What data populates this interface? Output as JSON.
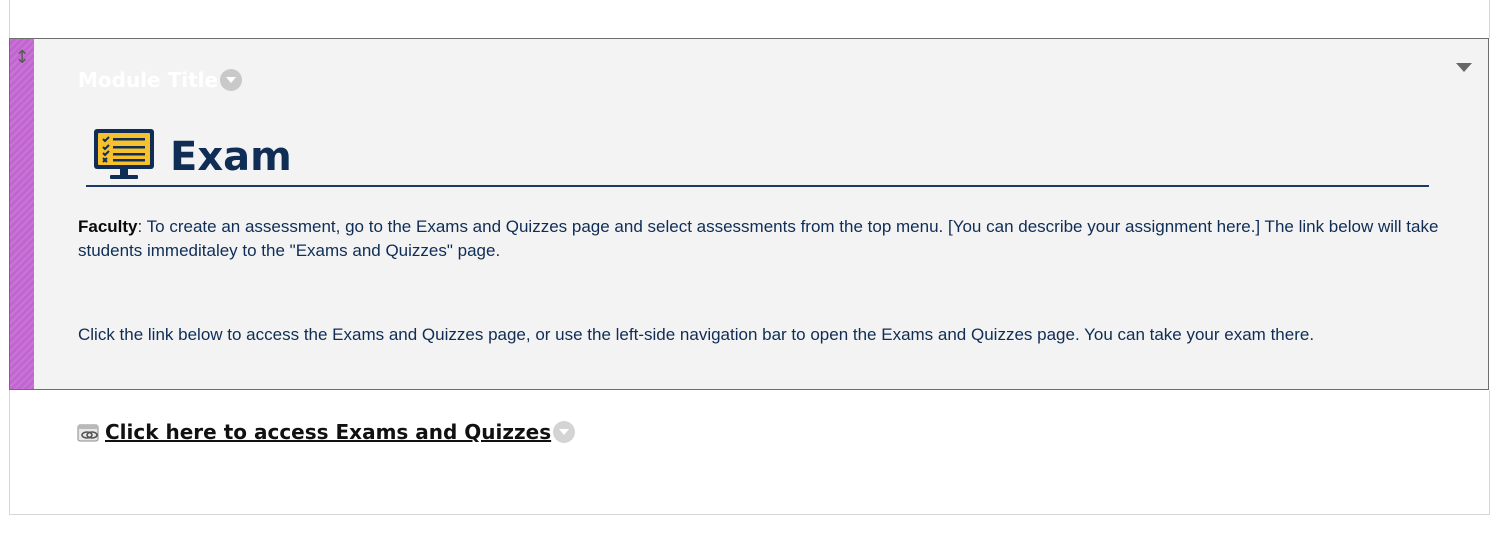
{
  "module": {
    "title": "Module Title",
    "accent_color": "#c265d1",
    "heading": "Exam",
    "heading_color": "#0f2d55",
    "faculty_label": "Faculty",
    "faculty_text": ": To create an assessment, go to the Exams and Quizzes page and select assessments from the top menu. [You can describe your assignment here.] The link below will take students immeditaley to the \"Exams and Quizzes\" page.",
    "instruction_text": "Click the link below to access the Exams and Quizzes page, or use the left-side navigation bar to open the Exams and Quizzes page. You can take your exam there."
  },
  "link_item": {
    "label": "Click here to access Exams and Quizzes",
    "icon": "web-link-icon"
  },
  "icons": {
    "drag": "drag-handle-icon",
    "title_menu": "chevron-down-icon",
    "collapse": "collapse-arrow-icon",
    "exam": "monitor-checklist-icon"
  }
}
